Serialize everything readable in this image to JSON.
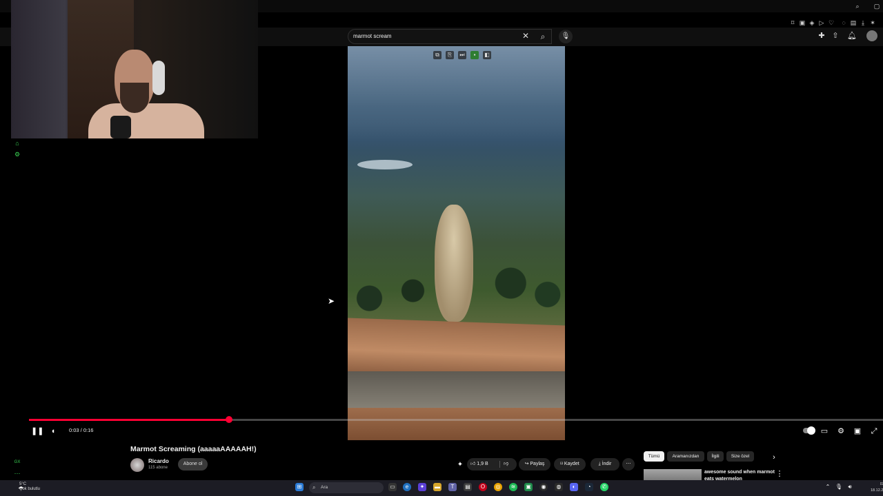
{
  "search": {
    "query": "marmot scream"
  },
  "player": {
    "time": "0:03 / 0:16",
    "progress_fraction": 0.234
  },
  "video": {
    "title": "Marmot Screaming (aaaaaAAAAAH!)"
  },
  "channel": {
    "name": "Ricardo",
    "subscribers": "115 abone",
    "subscribe_label": "Abone ol"
  },
  "actions": {
    "likes": "1,9 B",
    "share": "Paylaş",
    "save": "Kaydet",
    "download": "İndir"
  },
  "chips": [
    "Tümü",
    "Aramanızdan",
    "İlgili",
    "Size özel"
  ],
  "recommended": {
    "title": "awesome sound when marmot eats watermelon"
  },
  "sidebar": {
    "gx_label": "GX"
  },
  "taskbar": {
    "weather_temp": "5°C",
    "weather_desc": "Çok bulutlu",
    "search_label": "Ara",
    "clock_time": "03:",
    "clock_date": "18.12.20"
  },
  "colors": {
    "progress": "#ff0033",
    "accent_green": "#39d353",
    "bg": "#000000"
  }
}
